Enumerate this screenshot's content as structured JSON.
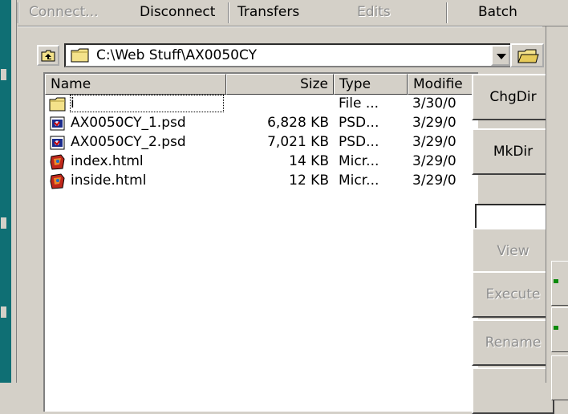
{
  "menu": {
    "connect": "Connect...",
    "disconnect": "Disconnect",
    "transfers": "Transfers",
    "edits": "Edits",
    "batch": "Batch"
  },
  "path": {
    "value": "C:\\Web Stuff\\AX0050CY",
    "up_icon": "up-folder-icon",
    "browse_icon": "open-folder-icon"
  },
  "columns": {
    "name": "Name",
    "size": "Size",
    "type": "Type",
    "modified": "Modifie"
  },
  "files": [
    {
      "name": "i",
      "size": "",
      "type": "File ...",
      "modified": "3/30/0",
      "icon": "folder-icon"
    },
    {
      "name": "AX0050CY_1.psd",
      "size": "6,828 KB",
      "type": "PSD...",
      "modified": "3/29/0",
      "icon": "psd-file-icon"
    },
    {
      "name": "AX0050CY_2.psd",
      "size": "7,021 KB",
      "type": "PSD...",
      "modified": "3/29/0",
      "icon": "psd-file-icon"
    },
    {
      "name": "index.html",
      "size": "14 KB",
      "type": "Micr...",
      "modified": "3/29/0",
      "icon": "html-file-icon"
    },
    {
      "name": "inside.html",
      "size": "12 KB",
      "type": "Micr...",
      "modified": "3/29/0",
      "icon": "html-file-icon"
    }
  ],
  "buttons": {
    "chgdir": "ChgDir",
    "mkdir": "MkDir",
    "view": "View",
    "execute": "Execute",
    "rename": "Rename"
  },
  "colors": {
    "teal": "#0f6f74",
    "face": "#d4d0c8",
    "folder": "#f4e28a"
  }
}
